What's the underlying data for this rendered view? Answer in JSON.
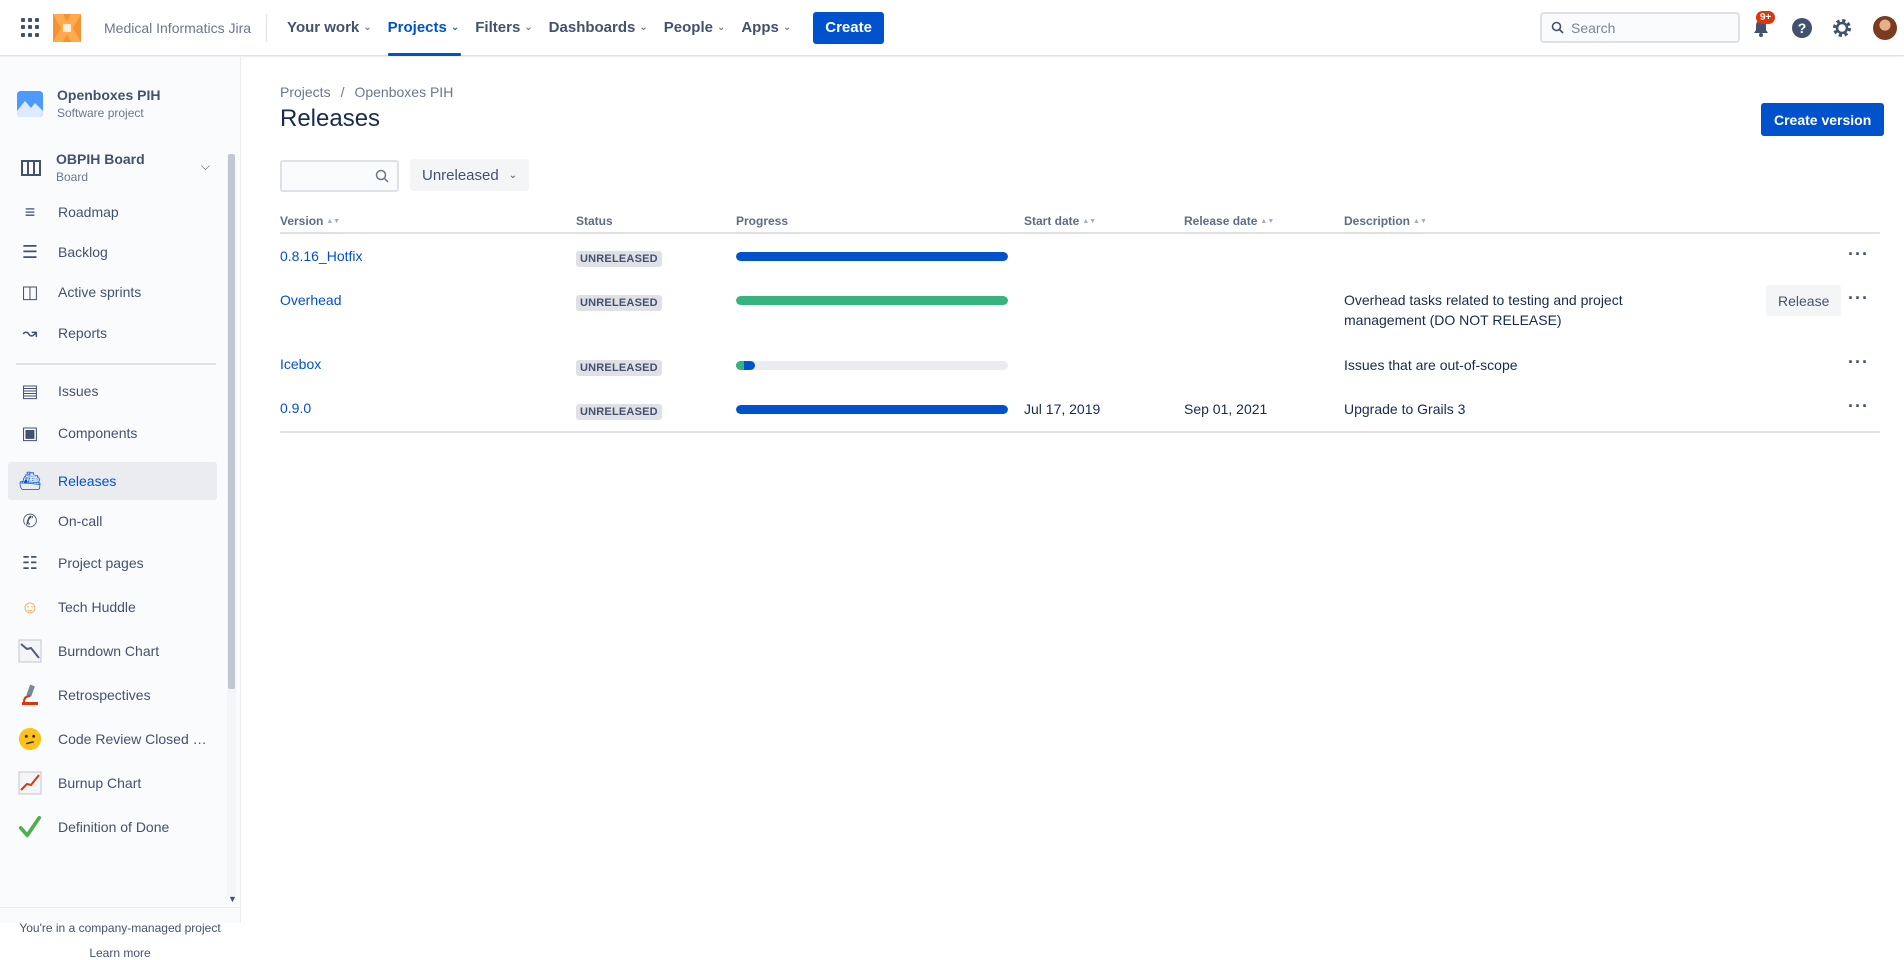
{
  "topnav": {
    "site_name": "Medical Informatics Jira",
    "items": [
      {
        "label": "Your work"
      },
      {
        "label": "Projects"
      },
      {
        "label": "Filters"
      },
      {
        "label": "Dashboards"
      },
      {
        "label": "People"
      },
      {
        "label": "Apps"
      }
    ],
    "create_label": "Create",
    "search_placeholder": "Search",
    "notification_badge": "9+"
  },
  "sidebar": {
    "project_name": "Openboxes PIH",
    "project_type": "Software project",
    "board_name": "OBPIH Board",
    "board_sub": "Board",
    "items": [
      {
        "label": "Roadmap",
        "icon": "roadmap-icon"
      },
      {
        "label": "Backlog",
        "icon": "backlog-icon"
      },
      {
        "label": "Active sprints",
        "icon": "board-icon"
      },
      {
        "label": "Reports",
        "icon": "reports-icon"
      },
      {
        "label": "Issues",
        "icon": "issues-icon"
      },
      {
        "label": "Components",
        "icon": "components-icon"
      },
      {
        "label": "Releases",
        "icon": "ship-icon"
      },
      {
        "label": "On-call",
        "icon": "phone-icon"
      },
      {
        "label": "Project pages",
        "icon": "page-icon"
      },
      {
        "label": "Tech Huddle",
        "icon": "people-emoji-icon"
      },
      {
        "label": "Burndown Chart",
        "icon": "chart-down-emoji-icon"
      },
      {
        "label": "Retrospectives",
        "icon": "microscope-emoji-icon"
      },
      {
        "label": "Code Review Closed …",
        "icon": "thinking-emoji-icon"
      },
      {
        "label": "Burnup Chart",
        "icon": "chart-up-emoji-icon"
      },
      {
        "label": "Definition of Done",
        "icon": "check-emoji-icon"
      }
    ],
    "footer_text": "You're in a company-managed project",
    "learn_more": "Learn more"
  },
  "main": {
    "breadcrumb": [
      "Projects",
      "Openboxes PIH"
    ],
    "title": "Releases",
    "create_version_label": "Create version",
    "filter_value": "Unreleased",
    "columns": [
      "Version",
      "Status",
      "Progress",
      "Start date",
      "Release date",
      "Description"
    ],
    "rows": [
      {
        "version": "0.8.16_Hotfix",
        "status": "UNRELEASED",
        "progress_done": 0,
        "progress_inprog": 1.0,
        "start": "",
        "release": "",
        "description": "",
        "action": ""
      },
      {
        "version": "Overhead",
        "status": "UNRELEASED",
        "progress_done": 1.0,
        "progress_inprog": 0,
        "start": "",
        "release": "",
        "description": "Overhead tasks related to testing and project management (DO NOT RELEASE)",
        "action": "Release"
      },
      {
        "version": "Icebox",
        "status": "UNRELEASED",
        "progress_done": 0.03,
        "progress_inprog": 0.04,
        "start": "",
        "release": "",
        "description": "Issues that are out-of-scope",
        "action": ""
      },
      {
        "version": "0.9.0",
        "status": "UNRELEASED",
        "progress_done": 0,
        "progress_inprog": 1.0,
        "start": "Jul 17, 2019",
        "release": "Sep 01, 2021",
        "description": "Upgrade to Grails 3",
        "action": ""
      }
    ]
  },
  "colors": {
    "brand": "#0052cc",
    "done": "#36b37e",
    "in_progress": "#0052cc"
  }
}
